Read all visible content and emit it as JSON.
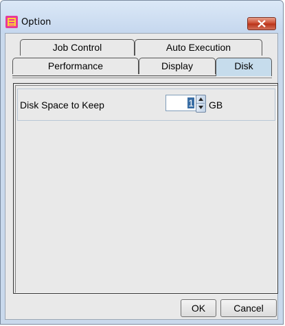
{
  "window": {
    "title": "Option",
    "close_icon": "close-icon"
  },
  "tabs": {
    "row1": [
      {
        "label": "Job Control"
      },
      {
        "label": "Auto Execution"
      }
    ],
    "row2": [
      {
        "label": "Performance"
      },
      {
        "label": "Display"
      },
      {
        "label": "Disk",
        "active": true
      }
    ]
  },
  "disk": {
    "label": "Disk Space to Keep",
    "value": "1",
    "unit": "GB"
  },
  "buttons": {
    "ok": "OK",
    "cancel": "Cancel"
  },
  "colors": {
    "active_tab": "#c6dcec",
    "close_button": "#c9462b",
    "selection": "#3a6ea5"
  }
}
